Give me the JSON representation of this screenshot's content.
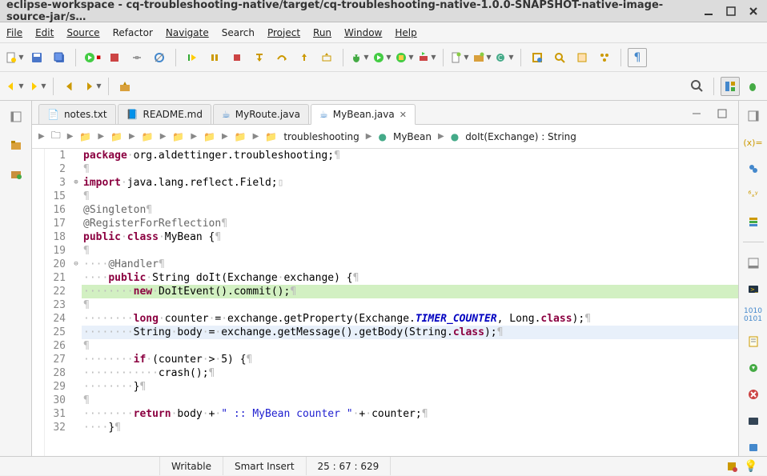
{
  "window": {
    "title": "eclipse-workspace - cq-troubleshooting-native/target/cq-troubleshooting-native-1.0.0-SNAPSHOT-native-image-source-jar/s…"
  },
  "menu": {
    "file": "File",
    "edit": "Edit",
    "source": "Source",
    "refactor": "Refactor",
    "navigate": "Navigate",
    "search": "Search",
    "project": "Project",
    "run": "Run",
    "window": "Window",
    "help": "Help"
  },
  "tabs": [
    {
      "label": "notes.txt",
      "active": false
    },
    {
      "label": "README.md",
      "active": false
    },
    {
      "label": "MyRoute.java",
      "active": false
    },
    {
      "label": "MyBean.java",
      "active": true
    }
  ],
  "breadcrumb": {
    "pkg": "troubleshooting",
    "class": "MyBean",
    "method": "doIt(Exchange) : String"
  },
  "code": {
    "lines": [
      {
        "n": "1",
        "tokens": [
          {
            "t": "package",
            "c": "kw"
          },
          {
            "t": "·",
            "c": "ws"
          },
          {
            "t": "org.aldettinger.troubleshooting;",
            "c": "typ"
          },
          {
            "t": "¶",
            "c": "para"
          }
        ]
      },
      {
        "n": "2",
        "tokens": [
          {
            "t": "¶",
            "c": "para"
          }
        ]
      },
      {
        "n": "3",
        "fold": "+",
        "tokens": [
          {
            "t": "import",
            "c": "kw"
          },
          {
            "t": "·",
            "c": "ws"
          },
          {
            "t": "java.lang.reflect.Field;",
            "c": "typ"
          },
          {
            "t": "▯",
            "c": "ws"
          }
        ]
      },
      {
        "n": "15",
        "tokens": [
          {
            "t": "¶",
            "c": "para"
          }
        ]
      },
      {
        "n": "16",
        "tokens": [
          {
            "t": "@Singleton",
            "c": "ann"
          },
          {
            "t": "¶",
            "c": "para"
          }
        ]
      },
      {
        "n": "17",
        "tokens": [
          {
            "t": "@RegisterForReflection",
            "c": "ann"
          },
          {
            "t": "¶",
            "c": "para"
          }
        ]
      },
      {
        "n": "18",
        "tokens": [
          {
            "t": "public",
            "c": "kw"
          },
          {
            "t": "·",
            "c": "ws"
          },
          {
            "t": "class",
            "c": "kw"
          },
          {
            "t": "·",
            "c": "ws"
          },
          {
            "t": "MyBean {",
            "c": "typ"
          },
          {
            "t": "¶",
            "c": "para"
          }
        ]
      },
      {
        "n": "19",
        "tokens": [
          {
            "t": "¶",
            "c": "para"
          }
        ]
      },
      {
        "n": "20",
        "fold": "-",
        "tokens": [
          {
            "t": "····",
            "c": "ws"
          },
          {
            "t": "@Handler",
            "c": "ann"
          },
          {
            "t": "¶",
            "c": "para"
          }
        ]
      },
      {
        "n": "21",
        "tokens": [
          {
            "t": "····",
            "c": "ws"
          },
          {
            "t": "public",
            "c": "kw"
          },
          {
            "t": "·",
            "c": "ws"
          },
          {
            "t": "String doIt(Exchange",
            "c": "typ"
          },
          {
            "t": "·",
            "c": "ws"
          },
          {
            "t": "exchange) {",
            "c": "typ"
          },
          {
            "t": "¶",
            "c": "para"
          }
        ]
      },
      {
        "n": "22",
        "hl": "green",
        "tokens": [
          {
            "t": "········",
            "c": "ws"
          },
          {
            "t": "new",
            "c": "kw"
          },
          {
            "t": "·",
            "c": "ws"
          },
          {
            "t": "DoItEvent().commit();",
            "c": "typ"
          },
          {
            "t": "¶",
            "c": "para"
          }
        ]
      },
      {
        "n": "23",
        "tokens": [
          {
            "t": "¶",
            "c": "para"
          }
        ]
      },
      {
        "n": "24",
        "tokens": [
          {
            "t": "········",
            "c": "ws"
          },
          {
            "t": "long",
            "c": "kw"
          },
          {
            "t": "·",
            "c": "ws"
          },
          {
            "t": "counter",
            "c": "typ"
          },
          {
            "t": "·",
            "c": "ws"
          },
          {
            "t": "=",
            "c": "typ"
          },
          {
            "t": "·",
            "c": "ws"
          },
          {
            "t": "exchange.getProperty(Exchange.",
            "c": "typ"
          },
          {
            "t": "TIMER_COUNTER",
            "c": "const"
          },
          {
            "t": ", Long.",
            "c": "typ"
          },
          {
            "t": "class",
            "c": "kw"
          },
          {
            "t": ");",
            "c": "typ"
          },
          {
            "t": "¶",
            "c": "para"
          }
        ]
      },
      {
        "n": "25",
        "hl": "blue",
        "tokens": [
          {
            "t": "········",
            "c": "ws"
          },
          {
            "t": "String",
            "c": "typ"
          },
          {
            "t": "·",
            "c": "ws"
          },
          {
            "t": "body",
            "c": "typ"
          },
          {
            "t": "·",
            "c": "ws"
          },
          {
            "t": "=",
            "c": "typ"
          },
          {
            "t": "·",
            "c": "ws"
          },
          {
            "t": "exchange.getMessage().getBody(String.",
            "c": "typ"
          },
          {
            "t": "class",
            "c": "kw"
          },
          {
            "t": ");",
            "c": "typ"
          },
          {
            "t": "¶",
            "c": "para"
          }
        ]
      },
      {
        "n": "26",
        "tokens": [
          {
            "t": "¶",
            "c": "para"
          }
        ]
      },
      {
        "n": "27",
        "tokens": [
          {
            "t": "········",
            "c": "ws"
          },
          {
            "t": "if",
            "c": "kw"
          },
          {
            "t": "·",
            "c": "ws"
          },
          {
            "t": "(counter",
            "c": "typ"
          },
          {
            "t": "·",
            "c": "ws"
          },
          {
            "t": ">",
            "c": "typ"
          },
          {
            "t": "·",
            "c": "ws"
          },
          {
            "t": "5) {",
            "c": "typ"
          },
          {
            "t": "¶",
            "c": "para"
          }
        ]
      },
      {
        "n": "28",
        "tokens": [
          {
            "t": "············",
            "c": "ws"
          },
          {
            "t": "crash();",
            "c": "typ"
          },
          {
            "t": "¶",
            "c": "para"
          }
        ]
      },
      {
        "n": "29",
        "tokens": [
          {
            "t": "········",
            "c": "ws"
          },
          {
            "t": "}",
            "c": "typ"
          },
          {
            "t": "¶",
            "c": "para"
          }
        ]
      },
      {
        "n": "30",
        "tokens": [
          {
            "t": "¶",
            "c": "para"
          }
        ]
      },
      {
        "n": "31",
        "tokens": [
          {
            "t": "········",
            "c": "ws"
          },
          {
            "t": "return",
            "c": "kw"
          },
          {
            "t": "·",
            "c": "ws"
          },
          {
            "t": "body",
            "c": "typ"
          },
          {
            "t": "·",
            "c": "ws"
          },
          {
            "t": "+",
            "c": "typ"
          },
          {
            "t": "·",
            "c": "ws"
          },
          {
            "t": "\" :: MyBean counter \"",
            "c": "str"
          },
          {
            "t": "·",
            "c": "ws"
          },
          {
            "t": "+",
            "c": "typ"
          },
          {
            "t": "·",
            "c": "ws"
          },
          {
            "t": "counter;",
            "c": "typ"
          },
          {
            "t": "¶",
            "c": "para"
          }
        ]
      },
      {
        "n": "32",
        "tokens": [
          {
            "t": "····",
            "c": "ws"
          },
          {
            "t": "}",
            "c": "typ"
          },
          {
            "t": "¶",
            "c": "para"
          }
        ]
      }
    ]
  },
  "status": {
    "writable": "Writable",
    "insert": "Smart Insert",
    "pos": "25 : 67 : 629"
  }
}
